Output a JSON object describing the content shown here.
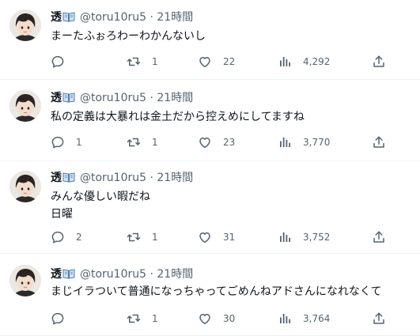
{
  "tweets": [
    {
      "name": "透",
      "handle": "@toru10ru5",
      "time": "· 21時間",
      "lines": [
        "まーたふぉろわーわかんないし"
      ],
      "reply_count": "",
      "retweet_count": "1",
      "like_count": "22",
      "view_count": "4,292"
    },
    {
      "name": "透",
      "handle": "@toru10ru5",
      "time": "· 21時間",
      "lines": [
        "私の定義は大暴れは金土だから控えめにしてますね"
      ],
      "reply_count": "1",
      "retweet_count": "1",
      "like_count": "23",
      "view_count": "3,770"
    },
    {
      "name": "透",
      "handle": "@toru10ru5",
      "time": "· 21時間",
      "lines": [
        "みんな優しい暇だね",
        "日曜"
      ],
      "reply_count": "2",
      "retweet_count": "1",
      "like_count": "31",
      "view_count": "3,752"
    },
    {
      "name": "透",
      "handle": "@toru10ru5",
      "time": "· 21時間",
      "lines": [
        "まじイラついて普通になっちゃってごめんねアドさんになれなくて"
      ],
      "reply_count": "",
      "retweet_count": "1",
      "like_count": "30",
      "view_count": "3,764"
    }
  ],
  "icons": {
    "name_badge": "open-book-icon",
    "reply": "reply-icon",
    "retweet": "retweet-icon",
    "like": "heart-icon",
    "views": "views-bar-chart-icon",
    "share": "share-icon"
  },
  "colors": {
    "text": "#0f1419",
    "muted": "#536471",
    "divider": "#eff3f4"
  }
}
